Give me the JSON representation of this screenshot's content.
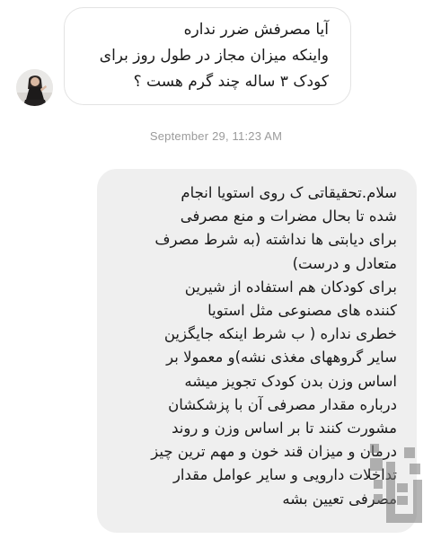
{
  "incoming_message": {
    "lines": [
      "آیا مصرفش ضرر نداره",
      "واینکه میزان مجاز در طول روز برای",
      "کودک ۳ ساله چند گرم هست ؟"
    ]
  },
  "timestamp": "September 29, 11:23 AM",
  "outgoing_message": {
    "lines": [
      "سلام.تحقیقاتی ک روی استویا انجام",
      "شده تا بحال مضرات و منع مصرفی",
      "برای دیابتی ها نداشته (به شرط مصرف",
      "متعادل و درست)",
      "برای کودکان هم استفاده از شیرین",
      "کننده های مصنوعی مثل استویا",
      "خطری نداره ( ب شرط اینکه جایگزین",
      "سایر گروههای مغذی نشه)و معمولا بر",
      "اساس وزن بدن کودک تجویز میشه",
      "درباره مقدار مصرفی آن با پزشکشان",
      "مشورت کنند تا بر اساس وزن و روند",
      "درمان و میزان قند خون و مهم ترین چیز",
      "تداخلات دارویی و سایر عوامل مقدار",
      "مصرفی تعیین بشه"
    ]
  },
  "avatar": {
    "icon": "user-avatar-photo"
  },
  "watermark": {
    "icon": "app-logo-watermark"
  }
}
